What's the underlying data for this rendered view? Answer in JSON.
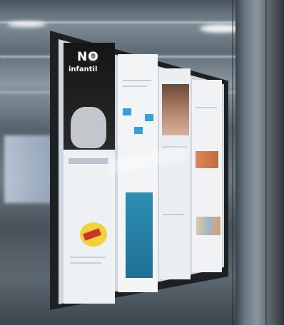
{
  "scene": {
    "poster_headline": "NO",
    "poster_subline": "infantil"
  },
  "colors": {
    "steel": "#6f7b85",
    "frame": "#1d2124",
    "poster_dark": "#151515",
    "accent_yellow": "#f2d23b",
    "accent_blue": "#2e8fb5"
  }
}
